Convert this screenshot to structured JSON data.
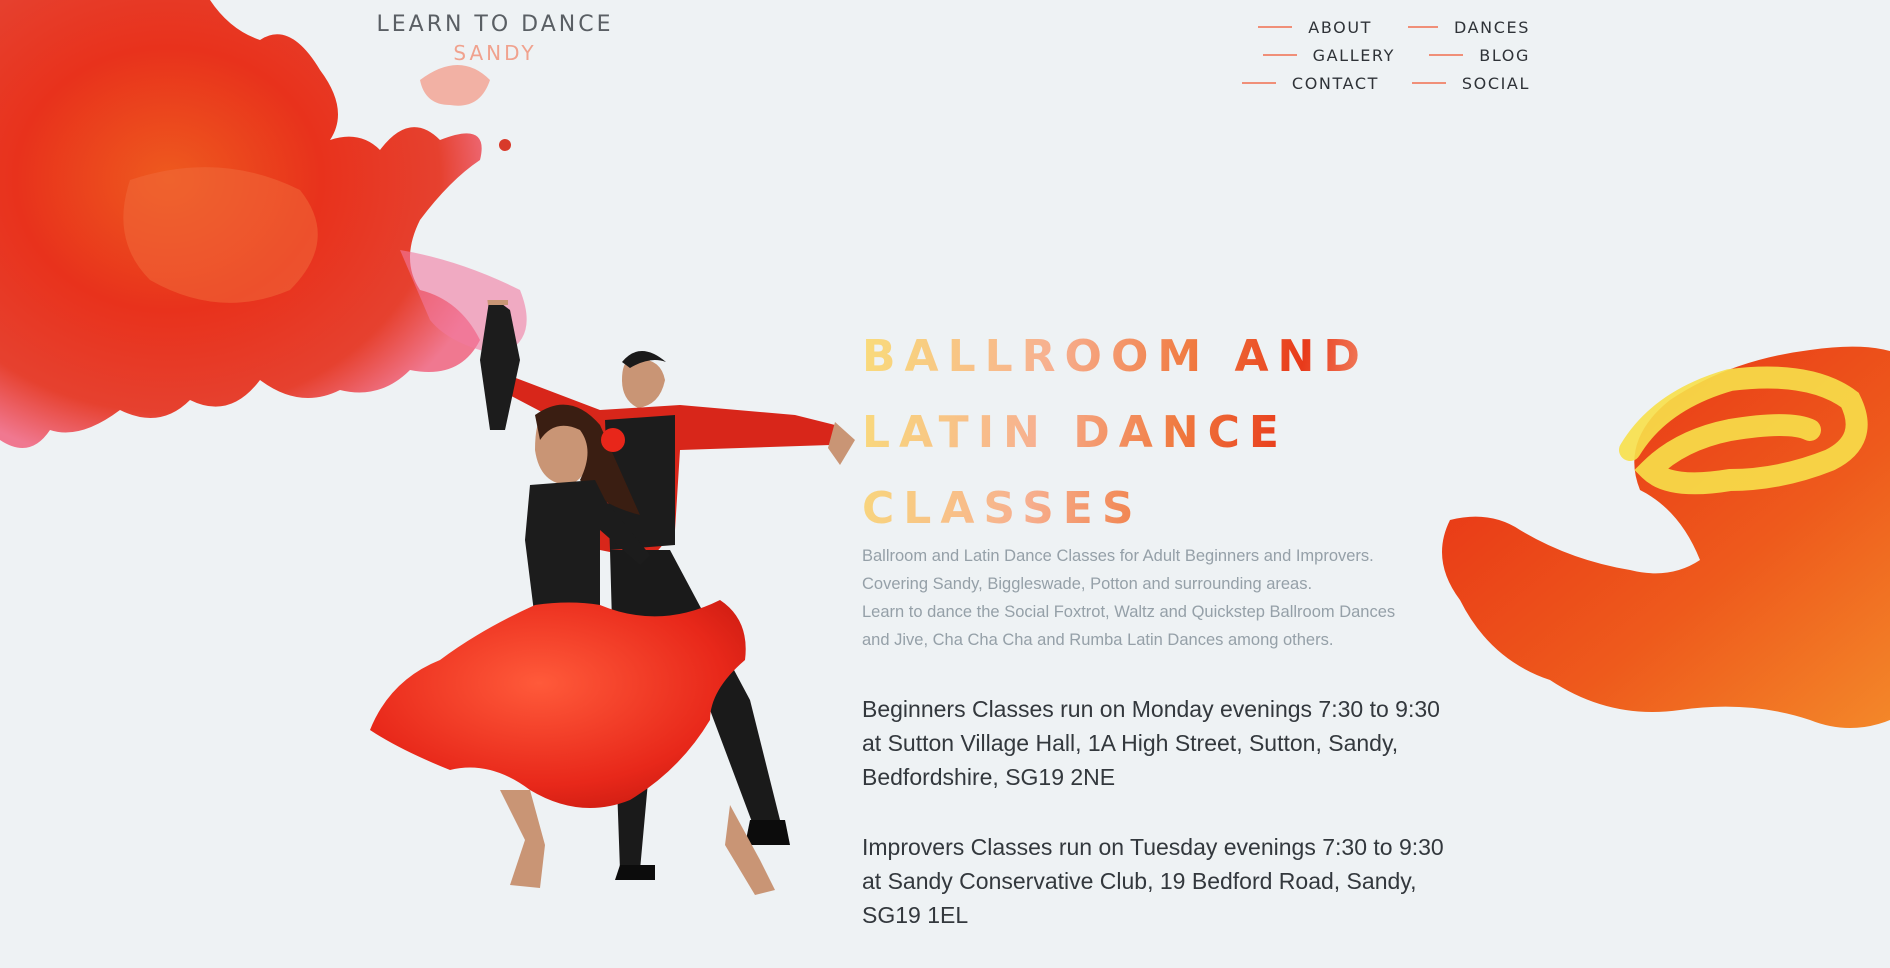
{
  "logo": {
    "title": "LEARN TO DANCE",
    "subtitle": "SANDY"
  },
  "nav": {
    "col1": [
      "ABOUT",
      "GALLERY",
      "CONTACT"
    ],
    "col2": [
      "DANCES",
      "BLOG",
      "SOCIAL"
    ]
  },
  "hero": {
    "headline": [
      "BALLROOM AND",
      "LATIN DANCE",
      "CLASSES"
    ],
    "intro": [
      "Ballroom and Latin Dance Classes for Adult Beginners and Improvers.",
      "Covering Sandy, Biggleswade, Potton and surrounding areas.",
      "Learn to dance the Social Foxtrot, Waltz and Quickstep Ballroom Dances",
      "and Jive, Cha Cha Cha and Rumba Latin Dances among others."
    ],
    "beginners": "Beginners Classes run on Monday evenings 7:30 to 9:30 at Sutton Village Hall, 1A High Street, Sutton, Sandy, Bedfordshire, SG19 2NE",
    "improvers": "Improvers Classes run on Tuesday evenings 7:30 to 9:30 at Sandy Conservative Club, 19 Bedford Road, Sandy, SG19 1EL"
  },
  "colors": {
    "background": "#eef2f4",
    "accent": "#f08f78",
    "brand_red": "#e8301a",
    "gold": "#f7c948"
  }
}
